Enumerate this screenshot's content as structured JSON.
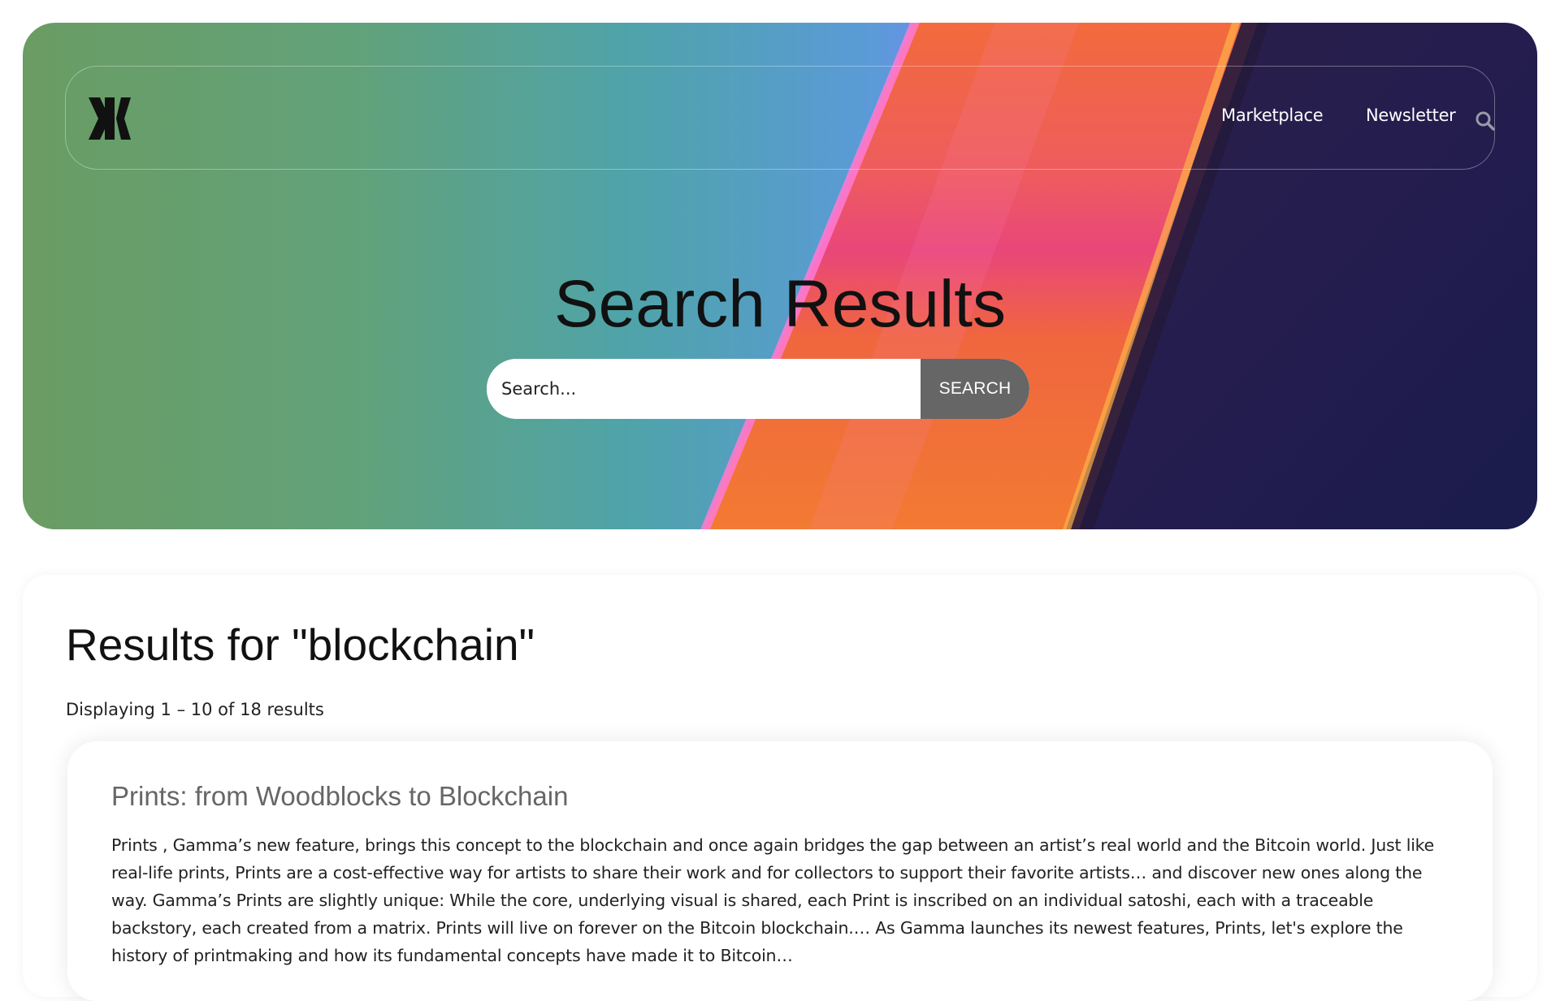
{
  "header": {
    "logo_icon": "gamma-logo-icon",
    "nav": [
      {
        "label": "Marketplace"
      },
      {
        "label": "Newsletter"
      }
    ],
    "search_icon": "search-icon"
  },
  "hero": {
    "title": "Search Results",
    "search_placeholder": "Search...",
    "search_button_label": "SEARCH"
  },
  "results": {
    "heading": "Results for \"blockchain\"",
    "count_text": "Displaying 1 – 10 of 18 results",
    "items": [
      {
        "title": "Prints: from Woodblocks to Blockchain",
        "excerpt": "Prints , Gamma’s new feature, brings this concept to the blockchain and once again bridges the gap between an artist’s real world and the Bitcoin world. Just like real-life prints, Prints are a cost-effective way for artists to share their work and for collectors to support their favorite artists… and discover new ones along the way. Gamma’s Prints are slightly unique: While the core, underlying visual is shared, each Print is inscribed on an individual satoshi, each with a traceable backstory, each created from a matrix. Prints will live on forever on the Bitcoin blockchain.… As Gamma launches its newest features, Prints, let's explore the history of printmaking and how its fundamental concepts have made it to Bitcoin…"
      }
    ]
  },
  "colors": {
    "search_button_bg": "#666666",
    "result_title": "#666666",
    "hero_dark": "#1e1a4a",
    "hero_pink": "#ec5a8a",
    "hero_orange": "#f07a3a"
  }
}
